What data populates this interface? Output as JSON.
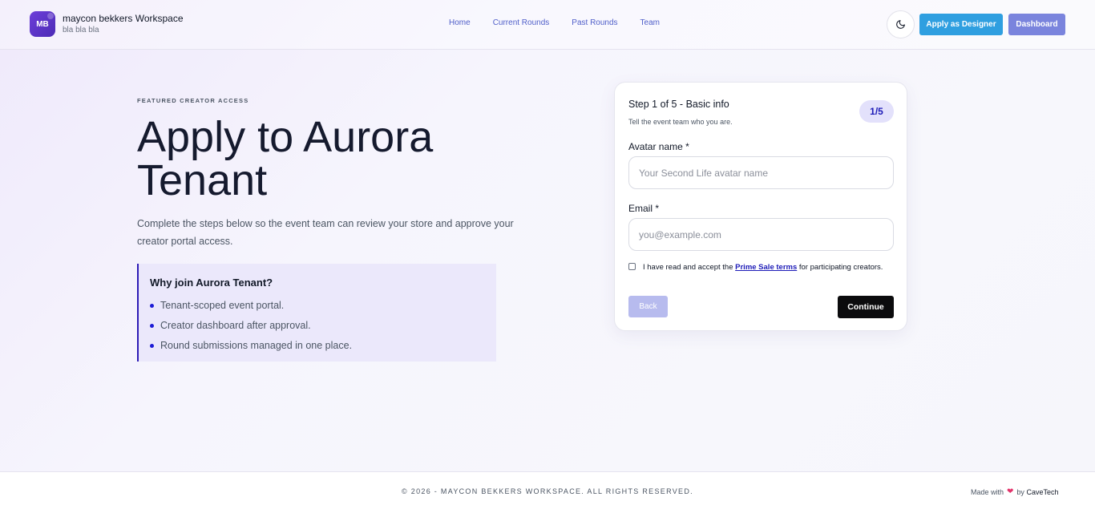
{
  "header": {
    "logo_initials": "MB",
    "workspace_title": "maycon bekkers Workspace",
    "workspace_subtitle": "bla bla bla",
    "nav": [
      {
        "label": "Home"
      },
      {
        "label": "Current Rounds"
      },
      {
        "label": "Past Rounds"
      },
      {
        "label": "Team"
      }
    ],
    "theme_toggle_icon": "moon-icon",
    "apply_designer_label": "Apply as Designer",
    "dashboard_label": "Dashboard"
  },
  "hero": {
    "eyebrow": "FEATURED CREATOR ACCESS",
    "title": "Apply to Aurora Tenant",
    "description": "Complete the steps below so the event team can review your store and approve your creator portal access.",
    "why_title": "Why join Aurora Tenant?",
    "why_items": [
      "Tenant-scoped event portal.",
      "Creator dashboard after approval.",
      "Round submissions managed in one place."
    ]
  },
  "form": {
    "step_title": "Step 1 of 5 - Basic info",
    "step_subtitle": "Tell the event team who you are.",
    "step_badge": "1/5",
    "avatar_label": "Avatar name *",
    "avatar_value": "",
    "avatar_placeholder": "Your Second Life avatar name",
    "email_label": "Email *",
    "email_value": "",
    "email_placeholder": "you@example.com",
    "terms_prefix": "I have read and accept the ",
    "terms_link": "Prime Sale terms",
    "terms_suffix": " for participating creators.",
    "terms_checked": false,
    "back_label": "Back",
    "continue_label": "Continue"
  },
  "footer": {
    "copyright": "© 2026 - MAYCON BEKKERS WORKSPACE. ALL RIGHTS RESERVED.",
    "made_with": "Made with",
    "by": "by",
    "brand": "CaveTech"
  },
  "colors": {
    "accent_blue": "#2f9fe0",
    "accent_indigo": "#7a84dd",
    "brand_purple": "#6d3fd9",
    "link_blue": "#1e1cb8",
    "heart": "#e2336b"
  }
}
